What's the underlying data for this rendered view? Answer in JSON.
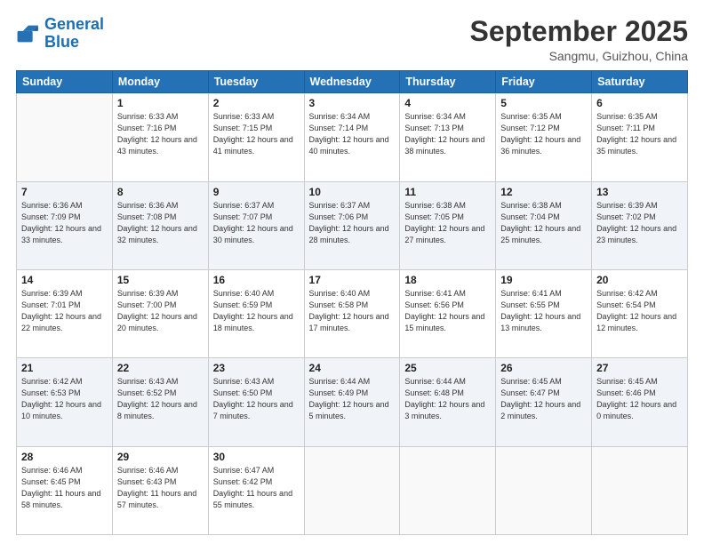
{
  "logo": {
    "line1": "General",
    "line2": "Blue"
  },
  "title": "September 2025",
  "location": "Sangmu, Guizhou, China",
  "days_of_week": [
    "Sunday",
    "Monday",
    "Tuesday",
    "Wednesday",
    "Thursday",
    "Friday",
    "Saturday"
  ],
  "weeks": [
    [
      {
        "num": "",
        "empty": true
      },
      {
        "num": "1",
        "sunrise": "6:33 AM",
        "sunset": "7:16 PM",
        "daylight": "12 hours and 43 minutes."
      },
      {
        "num": "2",
        "sunrise": "6:33 AM",
        "sunset": "7:15 PM",
        "daylight": "12 hours and 41 minutes."
      },
      {
        "num": "3",
        "sunrise": "6:34 AM",
        "sunset": "7:14 PM",
        "daylight": "12 hours and 40 minutes."
      },
      {
        "num": "4",
        "sunrise": "6:34 AM",
        "sunset": "7:13 PM",
        "daylight": "12 hours and 38 minutes."
      },
      {
        "num": "5",
        "sunrise": "6:35 AM",
        "sunset": "7:12 PM",
        "daylight": "12 hours and 36 minutes."
      },
      {
        "num": "6",
        "sunrise": "6:35 AM",
        "sunset": "7:11 PM",
        "daylight": "12 hours and 35 minutes."
      }
    ],
    [
      {
        "num": "7",
        "sunrise": "6:36 AM",
        "sunset": "7:09 PM",
        "daylight": "12 hours and 33 minutes."
      },
      {
        "num": "8",
        "sunrise": "6:36 AM",
        "sunset": "7:08 PM",
        "daylight": "12 hours and 32 minutes."
      },
      {
        "num": "9",
        "sunrise": "6:37 AM",
        "sunset": "7:07 PM",
        "daylight": "12 hours and 30 minutes."
      },
      {
        "num": "10",
        "sunrise": "6:37 AM",
        "sunset": "7:06 PM",
        "daylight": "12 hours and 28 minutes."
      },
      {
        "num": "11",
        "sunrise": "6:38 AM",
        "sunset": "7:05 PM",
        "daylight": "12 hours and 27 minutes."
      },
      {
        "num": "12",
        "sunrise": "6:38 AM",
        "sunset": "7:04 PM",
        "daylight": "12 hours and 25 minutes."
      },
      {
        "num": "13",
        "sunrise": "6:39 AM",
        "sunset": "7:02 PM",
        "daylight": "12 hours and 23 minutes."
      }
    ],
    [
      {
        "num": "14",
        "sunrise": "6:39 AM",
        "sunset": "7:01 PM",
        "daylight": "12 hours and 22 minutes."
      },
      {
        "num": "15",
        "sunrise": "6:39 AM",
        "sunset": "7:00 PM",
        "daylight": "12 hours and 20 minutes."
      },
      {
        "num": "16",
        "sunrise": "6:40 AM",
        "sunset": "6:59 PM",
        "daylight": "12 hours and 18 minutes."
      },
      {
        "num": "17",
        "sunrise": "6:40 AM",
        "sunset": "6:58 PM",
        "daylight": "12 hours and 17 minutes."
      },
      {
        "num": "18",
        "sunrise": "6:41 AM",
        "sunset": "6:56 PM",
        "daylight": "12 hours and 15 minutes."
      },
      {
        "num": "19",
        "sunrise": "6:41 AM",
        "sunset": "6:55 PM",
        "daylight": "12 hours and 13 minutes."
      },
      {
        "num": "20",
        "sunrise": "6:42 AM",
        "sunset": "6:54 PM",
        "daylight": "12 hours and 12 minutes."
      }
    ],
    [
      {
        "num": "21",
        "sunrise": "6:42 AM",
        "sunset": "6:53 PM",
        "daylight": "12 hours and 10 minutes."
      },
      {
        "num": "22",
        "sunrise": "6:43 AM",
        "sunset": "6:52 PM",
        "daylight": "12 hours and 8 minutes."
      },
      {
        "num": "23",
        "sunrise": "6:43 AM",
        "sunset": "6:50 PM",
        "daylight": "12 hours and 7 minutes."
      },
      {
        "num": "24",
        "sunrise": "6:44 AM",
        "sunset": "6:49 PM",
        "daylight": "12 hours and 5 minutes."
      },
      {
        "num": "25",
        "sunrise": "6:44 AM",
        "sunset": "6:48 PM",
        "daylight": "12 hours and 3 minutes."
      },
      {
        "num": "26",
        "sunrise": "6:45 AM",
        "sunset": "6:47 PM",
        "daylight": "12 hours and 2 minutes."
      },
      {
        "num": "27",
        "sunrise": "6:45 AM",
        "sunset": "6:46 PM",
        "daylight": "12 hours and 0 minutes."
      }
    ],
    [
      {
        "num": "28",
        "sunrise": "6:46 AM",
        "sunset": "6:45 PM",
        "daylight": "11 hours and 58 minutes."
      },
      {
        "num": "29",
        "sunrise": "6:46 AM",
        "sunset": "6:43 PM",
        "daylight": "11 hours and 57 minutes."
      },
      {
        "num": "30",
        "sunrise": "6:47 AM",
        "sunset": "6:42 PM",
        "daylight": "11 hours and 55 minutes."
      },
      {
        "num": "",
        "empty": true
      },
      {
        "num": "",
        "empty": true
      },
      {
        "num": "",
        "empty": true
      },
      {
        "num": "",
        "empty": true
      }
    ]
  ],
  "labels": {
    "sunrise": "Sunrise:",
    "sunset": "Sunset:",
    "daylight": "Daylight:"
  }
}
